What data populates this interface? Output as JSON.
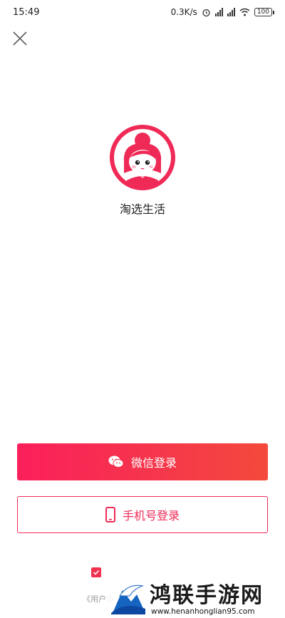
{
  "status_bar": {
    "time": "15:49",
    "speed": "0.3K/s",
    "battery": "100",
    "network_tag_1": "HD",
    "network_tag_2": "HD"
  },
  "header": {
    "close_icon": "close-icon"
  },
  "app": {
    "name": "淘选生活",
    "logo_icon": "girl-avatar-logo"
  },
  "login": {
    "wechat_label": "微信登录",
    "wechat_icon": "wechat-icon",
    "phone_label": "手机号登录",
    "phone_icon": "phone-icon"
  },
  "agreement": {
    "checked": true,
    "terms_text": "《用户协"
  },
  "watermark": {
    "title": "鸿联手游网",
    "url": "www.henanhonglian95.com"
  },
  "colors": {
    "brand": "#f02a57",
    "gradient_start": "#fb1f5b",
    "gradient_end": "#f4493c"
  }
}
